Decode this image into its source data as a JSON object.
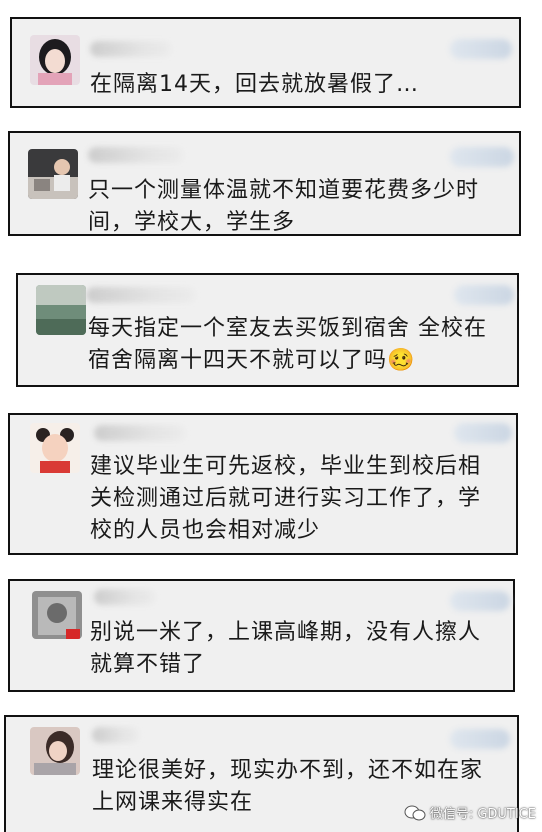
{
  "comments": [
    {
      "text": "在隔离14天，回去就放暑假了…"
    },
    {
      "text": "只一个测量体温就不知道要花费多少时\n间，学校大，学生多"
    },
    {
      "text": "每天指定一个室友去买饭到宿舍 全校在\n宿舍隔离十四天不就可以了吗🥴"
    },
    {
      "text": "建议毕业生可先返校，毕业生到校后相\n关检测通过后就可进行实习工作了，学\n校的人员也会相对减少"
    },
    {
      "text": "别说一米了，上课高峰期，没有人擦人\n就算不错了"
    },
    {
      "text": "理论很美好，现实办不到，还不如在家\n上网课来得实在"
    }
  ],
  "watermark": {
    "text": "微信号: GDUTICE"
  },
  "colors": {
    "card_bg": "#f0f0f0",
    "border": "#111111",
    "text": "#1a1a1a"
  }
}
